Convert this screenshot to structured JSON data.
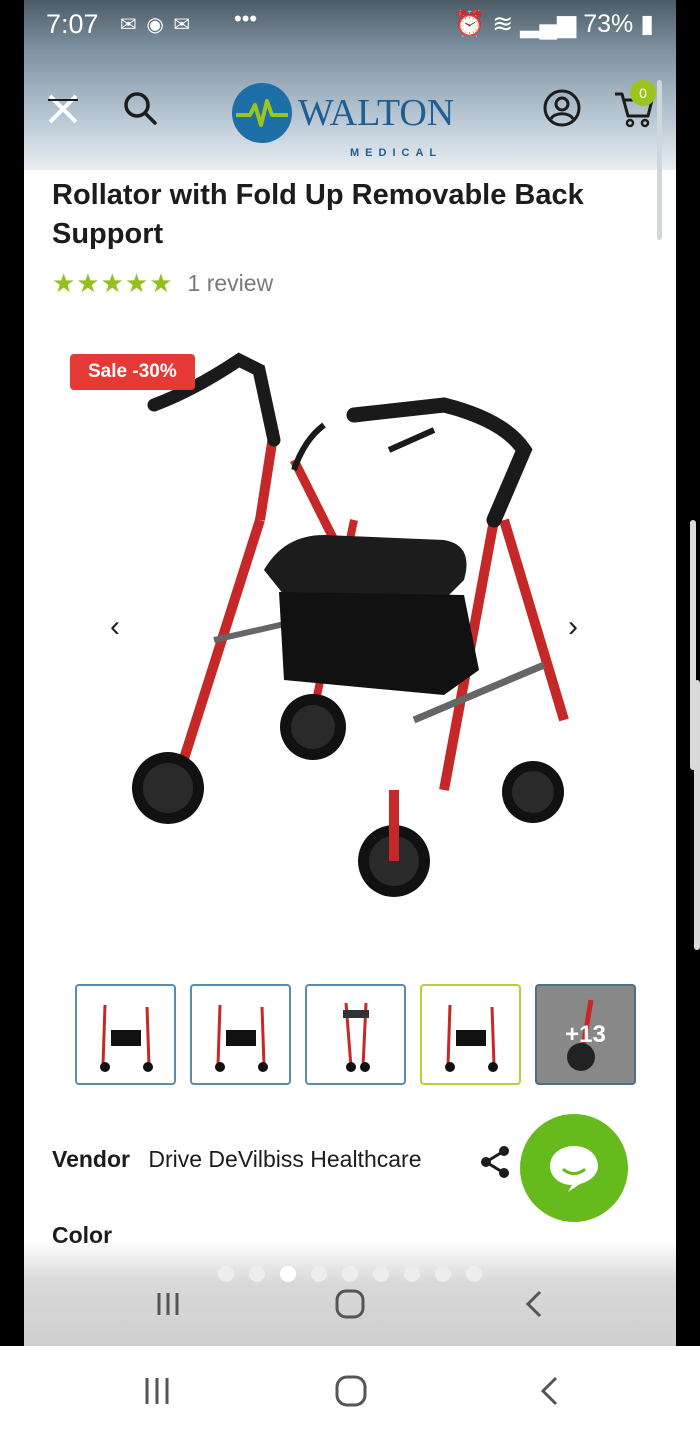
{
  "status_bar": {
    "time": "7:07",
    "notification_icons": [
      "messenger-icon",
      "temu-icon",
      "chat-icon",
      "email-icon"
    ],
    "more": "•••",
    "battery": "73%"
  },
  "header": {
    "logo_text": "WALTON",
    "logo_subtext": "MEDICAL",
    "cart_count": "0",
    "colors": {
      "accent": "#9cc41a",
      "brand": "#1e5e93"
    }
  },
  "product": {
    "title": "Rollator with Fold Up Removable Back Support",
    "rating_stars": "★★★★★",
    "rating_value": 5,
    "review_count": "1 review",
    "sale_badge": "Sale -30%",
    "image_alt": "Red rollator walker with seat",
    "more_images": "+13",
    "vendor_label": "Vendor",
    "vendor_value": "Drive DeVilbiss Healthcare",
    "color_label": "Color"
  },
  "gallery": {
    "page_count": 9,
    "active_page": 3
  }
}
